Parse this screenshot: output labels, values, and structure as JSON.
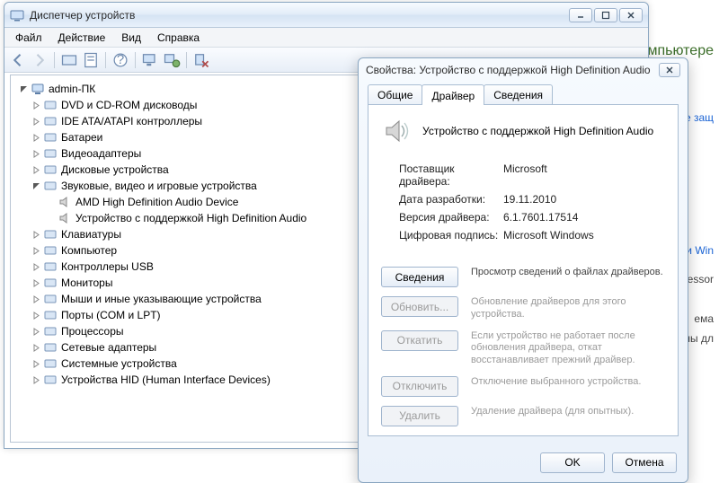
{
  "bg": {
    "rightTitle": "компьютере",
    "link1": "е защ",
    "link2": "и Win",
    "txt1": "essor",
    "txt2": "ема",
    "txt3": "ны дл"
  },
  "devmgr": {
    "title": "Диспетчер устройств",
    "menu": {
      "file": "Файл",
      "action": "Действие",
      "view": "Вид",
      "help": "Справка"
    },
    "root": "admin-ПК",
    "cats": [
      {
        "label": "DVD и CD-ROM дисководы"
      },
      {
        "label": "IDE ATA/ATAPI контроллеры"
      },
      {
        "label": "Батареи"
      },
      {
        "label": "Видеоадаптеры"
      },
      {
        "label": "Дисковые устройства"
      },
      {
        "label": "Звуковые, видео и игровые устройства",
        "expanded": true,
        "children": [
          "AMD High Definition Audio Device",
          "Устройство с поддержкой High Definition Audio"
        ]
      },
      {
        "label": "Клавиатуры"
      },
      {
        "label": "Компьютер"
      },
      {
        "label": "Контроллеры USB"
      },
      {
        "label": "Мониторы"
      },
      {
        "label": "Мыши и иные указывающие устройства"
      },
      {
        "label": "Порты (COM и LPT)"
      },
      {
        "label": "Процессоры"
      },
      {
        "label": "Сетевые адаптеры"
      },
      {
        "label": "Системные устройства"
      },
      {
        "label": "Устройства HID (Human Interface Devices)"
      }
    ]
  },
  "dlg": {
    "title": "Свойства: Устройство с поддержкой High Definition Audio",
    "tabs": {
      "general": "Общие",
      "driver": "Драйвер",
      "details": "Сведения"
    },
    "device": "Устройство с поддержкой High Definition Audio",
    "provider_k": "Поставщик драйвера:",
    "provider_v": "Microsoft",
    "date_k": "Дата разработки:",
    "date_v": "19.11.2010",
    "ver_k": "Версия драйвера:",
    "ver_v": "6.1.7601.17514",
    "sig_k": "Цифровая подпись:",
    "sig_v": "Microsoft Windows",
    "btn_details": "Сведения",
    "desc_details": "Просмотр сведений о файлах драйверов.",
    "btn_update": "Обновить...",
    "desc_update": "Обновление драйверов для этого устройства.",
    "btn_rollback": "Откатить",
    "desc_rollback": "Если устройство не работает после обновления драйвера, откат восстанавливает прежний драйвер.",
    "btn_disable": "Отключить",
    "desc_disable": "Отключение выбранного устройства.",
    "btn_uninst": "Удалить",
    "desc_uninst": "Удаление драйвера (для опытных).",
    "ok": "OK",
    "cancel": "Отмена"
  }
}
